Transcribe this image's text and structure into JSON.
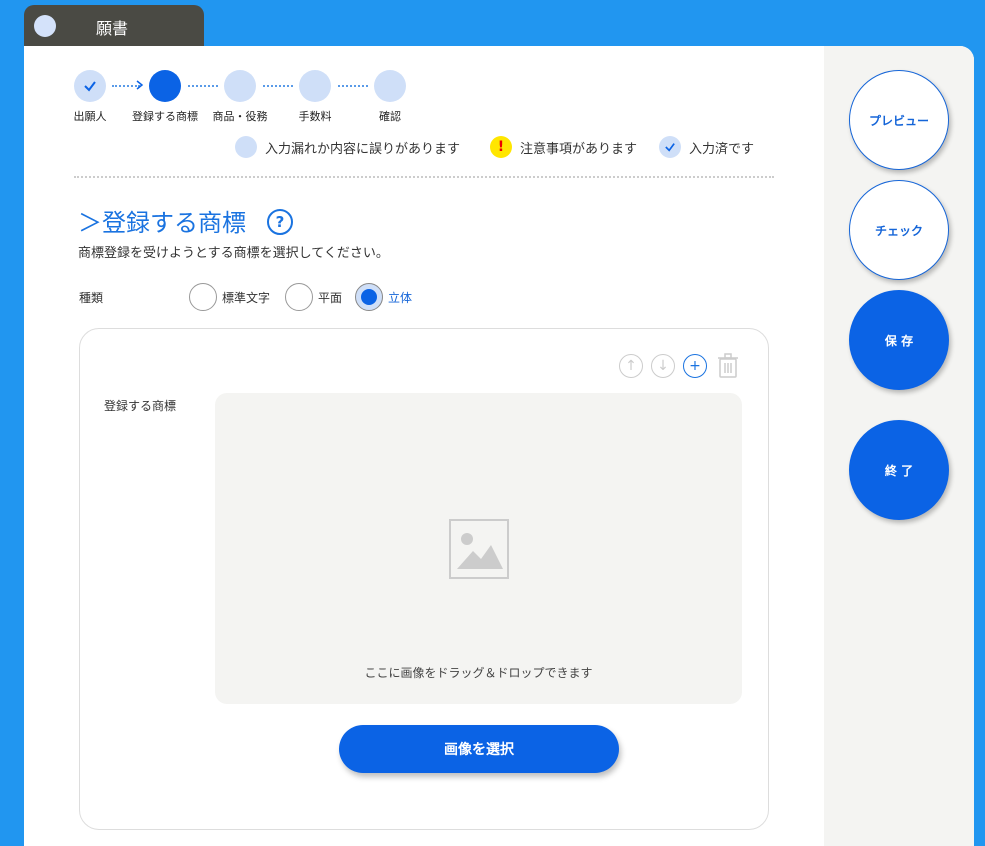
{
  "window": {
    "tab_title": "願書"
  },
  "steps": [
    {
      "label": "出願人",
      "state": "done"
    },
    {
      "label": "登録する商標",
      "state": "current"
    },
    {
      "label": "商品・役務",
      "state": "pending"
    },
    {
      "label": "手数料",
      "state": "pending"
    },
    {
      "label": "確認",
      "state": "pending"
    }
  ],
  "legend": {
    "error": "入力漏れか内容に誤りがあります",
    "warning": "注意事項があります",
    "done": "入力済です"
  },
  "section": {
    "title": "＞登録する商標",
    "help_glyph": "?",
    "description": "商標登録を受けようとする商標を選択してください。"
  },
  "trademark_type": {
    "label": "種類",
    "options": [
      "標準文字",
      "平面",
      "立体"
    ],
    "selected": "立体"
  },
  "card": {
    "field_label": "登録する商標",
    "drop_text": "ここに画像をドラッグ＆ドロップできます",
    "select_button": "画像を選択",
    "controls": [
      "move-up-icon",
      "move-down-icon",
      "add-icon",
      "trash-icon"
    ]
  },
  "sidebar": {
    "preview": "プレビュー",
    "check": "チェック",
    "save": "保 存",
    "exit": "終 了"
  },
  "colors": {
    "accent": "#0b63e5",
    "background": "#2196f0",
    "warning": "#ffe600"
  }
}
